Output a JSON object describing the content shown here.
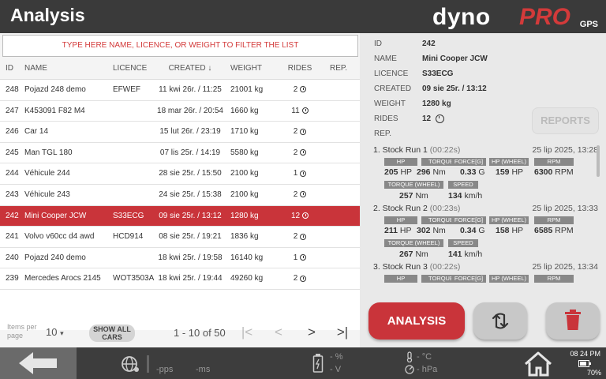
{
  "header": {
    "title": "Analysis",
    "logo_dyno": "dyno",
    "logo_pro": "PRO",
    "logo_gps": "GPS"
  },
  "filter": {
    "placeholder": "TYPE HERE NAME, LICENCE, OR WEIGHT TO FILTER THE LIST"
  },
  "table": {
    "headers": {
      "id": "ID",
      "name": "NAME",
      "licence": "LICENCE",
      "created": "CREATED",
      "sort_arrow": "↓",
      "weight": "WEIGHT",
      "rides": "RIDES",
      "rep": "REP."
    },
    "rows": [
      {
        "id": "248",
        "name": "Pojazd 248 demo",
        "licence": "EFWEF",
        "created": "11 kwi 26r. / 11:25",
        "weight": "21001 kg",
        "rides": "2"
      },
      {
        "id": "247",
        "name": "K453091 F82 M4",
        "licence": "",
        "created": "18 mar 26r. / 20:54",
        "weight": "1660 kg",
        "rides": "11"
      },
      {
        "id": "246",
        "name": "Car 14",
        "licence": "",
        "created": "15 lut 26r. / 23:19",
        "weight": "1710 kg",
        "rides": "2"
      },
      {
        "id": "245",
        "name": "Man TGL 180",
        "licence": "",
        "created": "07 lis 25r. / 14:19",
        "weight": "5580 kg",
        "rides": "2"
      },
      {
        "id": "244",
        "name": "Véhicule 244",
        "licence": "",
        "created": "28 sie 25r. / 15:50",
        "weight": "2100 kg",
        "rides": "1"
      },
      {
        "id": "243",
        "name": "Véhicule 243",
        "licence": "",
        "created": "24 sie 25r. / 15:38",
        "weight": "2100 kg",
        "rides": "2"
      },
      {
        "id": "242",
        "name": "Mini Cooper JCW",
        "licence": "S33ECG",
        "created": "09 sie 25r. / 13:12",
        "weight": "1280 kg",
        "rides": "12",
        "selected": true
      },
      {
        "id": "241",
        "name": "Volvo v60cc d4 awd",
        "licence": "HCD914",
        "created": "08 sie 25r. / 19:21",
        "weight": "1836 kg",
        "rides": "2"
      },
      {
        "id": "240",
        "name": "Pojazd 240 demo",
        "licence": "",
        "created": "18 kwi 25r. / 19:58",
        "weight": "16140 kg",
        "rides": "1"
      },
      {
        "id": "239",
        "name": "Mercedes Arocs 2145",
        "licence": "WOT3503A",
        "created": "18 kwi 25r. / 19:44",
        "weight": "49260 kg",
        "rides": "2"
      }
    ]
  },
  "pager": {
    "items_per_page_label": "Items per page",
    "items_per_page": "10",
    "dropdown_arrow": "▾",
    "show_all": "SHOW ALL CARS",
    "range": "1 - 10 of 50",
    "first": "|<",
    "prev": "<",
    "next": ">",
    "last": ">|"
  },
  "details": {
    "id_label": "ID",
    "id": "242",
    "name_label": "NAME",
    "name": "Mini Cooper JCW",
    "licence_label": "LICENCE",
    "licence": "S33ECG",
    "created_label": "CREATED",
    "created": "09 sie 25r. / 13:12",
    "weight_label": "WEIGHT",
    "weight": "1280 kg",
    "rides_label": "RIDES",
    "rides": "12",
    "rep_label": "REP.",
    "reports_button": "REPORTS"
  },
  "runs": [
    {
      "title": "1. Stock Run 1",
      "duration": "(00:22s)",
      "date": "25 lip 2025, 13:28",
      "hp": "205",
      "torque": "296",
      "force": "0.33",
      "hp_wheel": "159",
      "rpm": "6300",
      "torque_wheel": "257",
      "speed": "134"
    },
    {
      "title": "2. Stock Run 2",
      "duration": "(00:23s)",
      "date": "25 lip 2025, 13:33",
      "hp": "211",
      "torque": "302",
      "force": "0.34",
      "hp_wheel": "158",
      "rpm": "6585",
      "torque_wheel": "267",
      "speed": "141"
    },
    {
      "title": "3. Stock Run 3",
      "duration": "(00:22s)",
      "date": "25 lip 2025, 13:34",
      "hp": "",
      "torque": "",
      "force": "",
      "hp_wheel": "",
      "rpm": "",
      "torque_wheel": "",
      "speed": ""
    }
  ],
  "run_labels": {
    "hp": "HP",
    "torque": "TORQUE",
    "force": "FORCE[G]",
    "hp_wheel": "HP (WHEEL)",
    "rpm": "RPM",
    "torque_wheel": "TORQUE (WHEEL)",
    "speed": "SPEED",
    "u_hp": "HP",
    "u_nm": "Nm",
    "u_g": "G",
    "u_rpm": "RPM",
    "u_kmh": "km/h"
  },
  "actions": {
    "analysis": "ANALYSIS"
  },
  "status": {
    "pps": "-pps",
    "ms": "-ms",
    "percent": "- %",
    "volt": "- V",
    "temp": "- °C",
    "pressure": "- hPa",
    "time": "08 24 PM",
    "battery": "70%"
  },
  "colors": {
    "accent": "#c9343a",
    "header_bg": "#3a3a3a",
    "bottom_bg": "#3d3d3d"
  }
}
